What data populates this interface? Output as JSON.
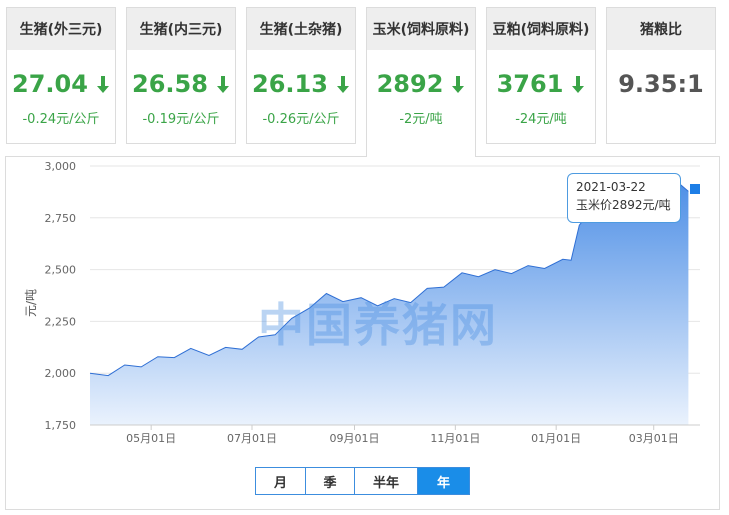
{
  "cards": [
    {
      "title": "生猪(外三元)",
      "value": "27.04",
      "trend": "down",
      "change": "-0.24元/公斤"
    },
    {
      "title": "生猪(内三元)",
      "value": "26.58",
      "trend": "down",
      "change": "-0.19元/公斤"
    },
    {
      "title": "生猪(土杂猪)",
      "value": "26.13",
      "trend": "down",
      "change": "-0.26元/公斤"
    },
    {
      "title": "玉米(饲料原料)",
      "value": "2892",
      "trend": "down",
      "change": "-2元/吨",
      "active": true
    },
    {
      "title": "豆粕(饲料原料)",
      "value": "3761",
      "trend": "down",
      "change": "-24元/吨"
    },
    {
      "title": "猪粮比",
      "value": "9.35:1",
      "trend": "none",
      "change": ""
    }
  ],
  "colors": {
    "accent": "#1a8de8",
    "down": "#3aa447",
    "area_top": "#4e8fe6",
    "area_bottom": "#eaf2fd",
    "line": "#2f6fd4"
  },
  "watermark": "中国养猪网",
  "tooltip": {
    "date": "2021-03-22",
    "text": "玉米价2892元/吨"
  },
  "range_buttons": [
    {
      "label": "月",
      "active": false
    },
    {
      "label": "季",
      "active": false
    },
    {
      "label": "半年",
      "active": false
    },
    {
      "label": "年",
      "active": true
    }
  ],
  "chart_data": {
    "type": "area",
    "ylabel": "元/吨",
    "ylim": [
      1750,
      3000
    ],
    "yticks": [
      "1,750",
      "2,000",
      "2,250",
      "2,500",
      "2,750",
      "3,000"
    ],
    "xlim": [
      "2020-03-25",
      "2021-03-29"
    ],
    "xticks": [
      {
        "date": "2020-05-01",
        "label": "05月01日"
      },
      {
        "date": "2020-07-01",
        "label": "07月01日"
      },
      {
        "date": "2020-09-01",
        "label": "09月01日"
      },
      {
        "date": "2020-11-01",
        "label": "11月01日"
      },
      {
        "date": "2021-01-01",
        "label": "01月01日"
      },
      {
        "date": "2021-03-01",
        "label": "03月01日"
      }
    ],
    "series": [
      {
        "name": "玉米价",
        "points": [
          [
            "2020-03-25",
            1985
          ],
          [
            "2020-04-05",
            2003
          ],
          [
            "2020-04-15",
            2025
          ],
          [
            "2020-04-25",
            2045
          ],
          [
            "2020-05-05",
            2065
          ],
          [
            "2020-05-15",
            2090
          ],
          [
            "2020-05-25",
            2105
          ],
          [
            "2020-06-05",
            2100
          ],
          [
            "2020-06-15",
            2110
          ],
          [
            "2020-06-25",
            2130
          ],
          [
            "2020-07-05",
            2160
          ],
          [
            "2020-07-15",
            2200
          ],
          [
            "2020-07-25",
            2250
          ],
          [
            "2020-08-05",
            2330
          ],
          [
            "2020-08-15",
            2370
          ],
          [
            "2020-08-25",
            2360
          ],
          [
            "2020-09-05",
            2350
          ],
          [
            "2020-09-15",
            2340
          ],
          [
            "2020-09-25",
            2345
          ],
          [
            "2020-10-05",
            2355
          ],
          [
            "2020-10-15",
            2395
          ],
          [
            "2020-10-25",
            2430
          ],
          [
            "2020-11-05",
            2470
          ],
          [
            "2020-11-15",
            2480
          ],
          [
            "2020-11-25",
            2485
          ],
          [
            "2020-12-05",
            2495
          ],
          [
            "2020-12-15",
            2505
          ],
          [
            "2020-12-25",
            2520
          ],
          [
            "2021-01-05",
            2535
          ],
          [
            "2021-01-10",
            2560
          ],
          [
            "2021-01-15",
            2700
          ],
          [
            "2021-01-25",
            2830
          ],
          [
            "2021-02-05",
            2870
          ],
          [
            "2021-02-15",
            2885
          ],
          [
            "2021-02-25",
            2900
          ],
          [
            "2021-03-05",
            2905
          ],
          [
            "2021-03-15",
            2910
          ],
          [
            "2021-03-22",
            2892
          ]
        ]
      }
    ]
  }
}
